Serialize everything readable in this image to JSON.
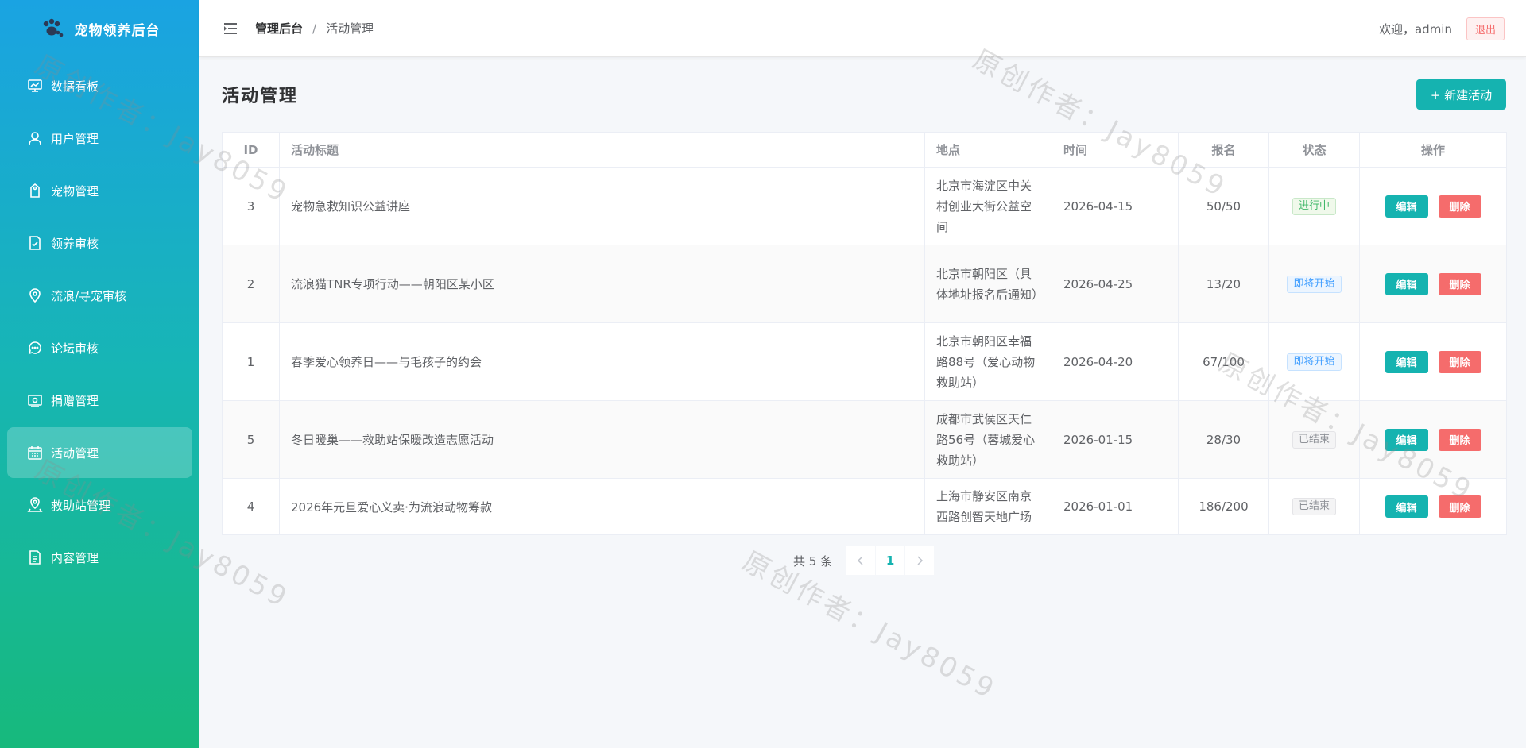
{
  "brand": {
    "title": "宠物领养后台",
    "icon": "paw-icon"
  },
  "sidebar": {
    "items": [
      {
        "label": "数据看板",
        "icon": "dashboard-icon"
      },
      {
        "label": "用户管理",
        "icon": "user-icon"
      },
      {
        "label": "宠物管理",
        "icon": "tag-icon"
      },
      {
        "label": "领养审核",
        "icon": "document-check-icon"
      },
      {
        "label": "流浪/寻宠审核",
        "icon": "location-icon"
      },
      {
        "label": "论坛审核",
        "icon": "chat-icon"
      },
      {
        "label": "捐赠管理",
        "icon": "money-icon"
      },
      {
        "label": "活动管理",
        "icon": "calendar-icon",
        "active": true
      },
      {
        "label": "救助站管理",
        "icon": "map-pin-icon"
      },
      {
        "label": "内容管理",
        "icon": "document-icon"
      }
    ]
  },
  "header": {
    "breadcrumb_root": "管理后台",
    "breadcrumb_sep": "/",
    "breadcrumb_current": "活动管理",
    "welcome": "欢迎，admin",
    "logout": "退出"
  },
  "page": {
    "title": "活动管理",
    "new_button": "+ 新建活动"
  },
  "table": {
    "columns": [
      "ID",
      "活动标题",
      "地点",
      "时间",
      "报名",
      "状态",
      "操作"
    ],
    "rows": [
      {
        "id": "3",
        "title": "宠物急救知识公益讲座",
        "location": "北京市海淀区中关村创业大街公益空间",
        "time": "2026-04-15",
        "signup": "50/50",
        "status": "进行中",
        "status_color": "green"
      },
      {
        "id": "2",
        "title": "流浪猫TNR专项行动——朝阳区某小区",
        "location": "北京市朝阳区（具体地址报名后通知）",
        "time": "2026-04-25",
        "signup": "13/20",
        "status": "即将开始",
        "status_color": "blue"
      },
      {
        "id": "1",
        "title": "春季爱心领养日——与毛孩子的约会",
        "location": "北京市朝阳区幸福路88号（爱心动物救助站）",
        "time": "2026-04-20",
        "signup": "67/100",
        "status": "即将开始",
        "status_color": "blue"
      },
      {
        "id": "5",
        "title": "冬日暖巢——救助站保暖改造志愿活动",
        "location": "成都市武侯区天仁路56号（蓉城爱心救助站）",
        "time": "2026-01-15",
        "signup": "28/30",
        "status": "已结束",
        "status_color": "gray"
      },
      {
        "id": "4",
        "title": "2026年元旦爱心义卖·为流浪动物筹款",
        "location": "上海市静安区南京西路创智天地广场",
        "time": "2026-01-01",
        "signup": "186/200",
        "status": "已结束",
        "status_color": "gray"
      }
    ],
    "edit_label": "编辑",
    "delete_label": "删除"
  },
  "pagination": {
    "total_text": "共 5 条",
    "current_page": "1",
    "prev_icon": "chevron-left-icon",
    "next_icon": "chevron-right-icon"
  },
  "watermark": "原创作者：Jay8059",
  "colors": {
    "accent": "#15b3b0",
    "danger": "#f56c6c",
    "sidebar_top": "#1aa3e2",
    "sidebar_bottom": "#17b97c"
  }
}
